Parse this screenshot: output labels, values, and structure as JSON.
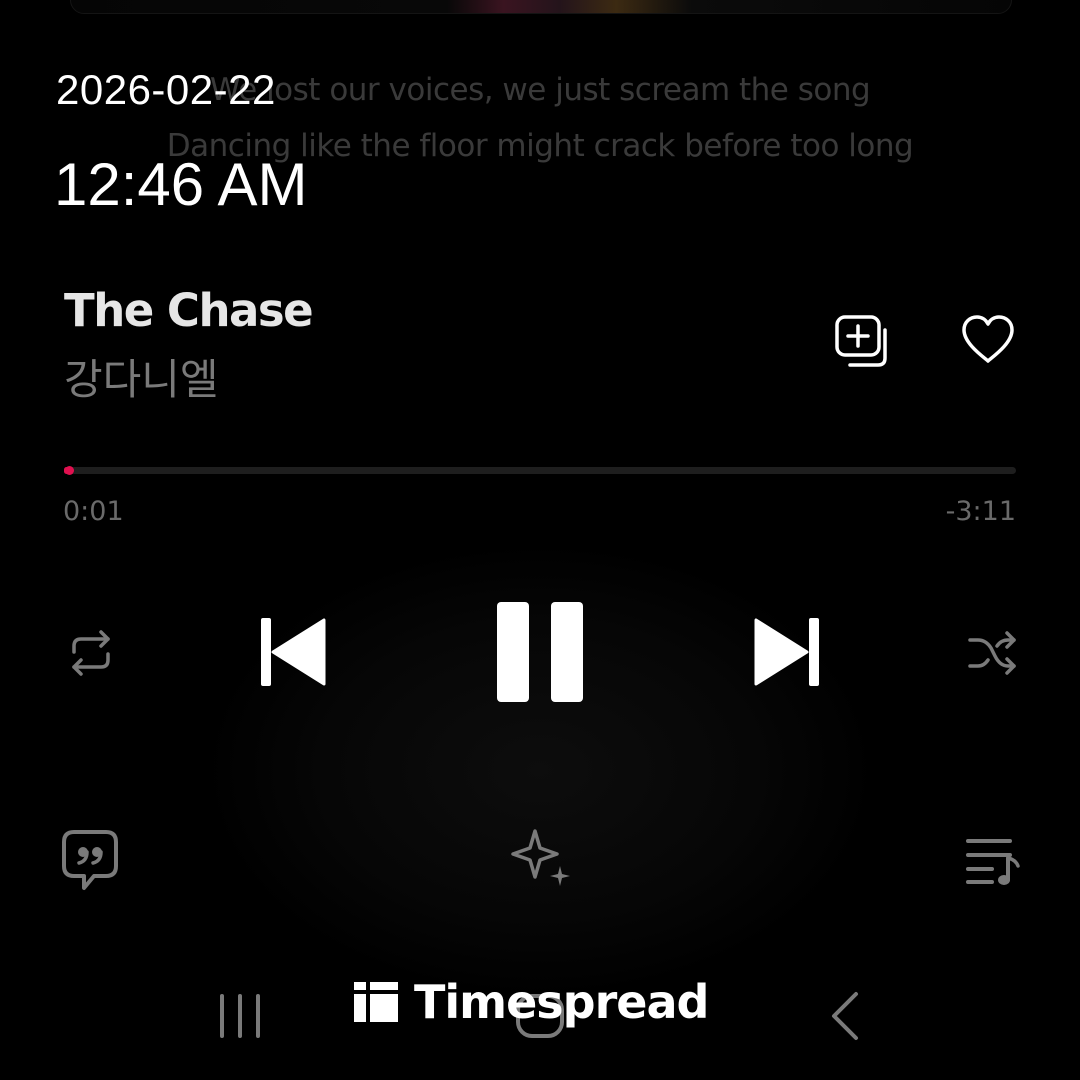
{
  "overlay": {
    "date": "2026-02-22",
    "time": "12:46 AM"
  },
  "lyrics": {
    "line1": "We lost our voices, we just scream the song",
    "line2": "Dancing like the floor might crack before too long"
  },
  "track": {
    "title": "The Chase",
    "artist": "강다니엘",
    "elapsed": "0:01",
    "remaining": "-3:11",
    "progress_fraction": 0.005
  },
  "icons": {
    "add_to_playlist": "add-to-playlist-icon",
    "favorite": "heart-icon",
    "repeat": "repeat-icon",
    "previous": "skip-previous-icon",
    "pause": "pause-icon",
    "next": "skip-next-icon",
    "shuffle": "shuffle-icon",
    "lyrics": "lyrics-quote-icon",
    "ai": "sparkle-icon",
    "queue": "queue-music-icon",
    "nav_recents": "recents-icon",
    "nav_home": "home-icon",
    "nav_back": "back-icon"
  },
  "colors": {
    "accent": "#e0104f",
    "background": "#000000"
  },
  "watermark": {
    "text": "Timespread"
  }
}
